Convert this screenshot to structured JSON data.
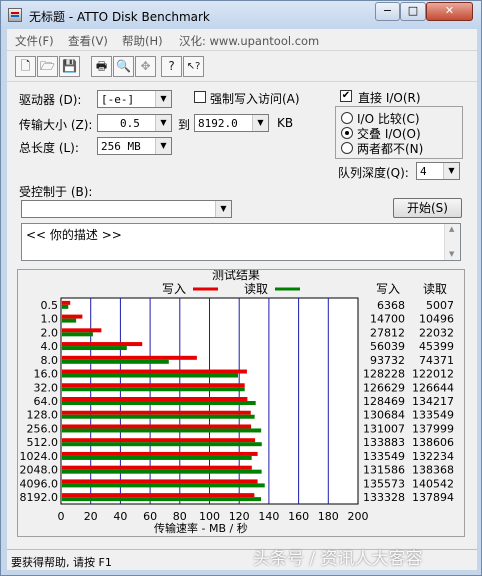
{
  "window": {
    "title": "无标题 - ATTO Disk Benchmark",
    "minimize": "−",
    "maximize": "□",
    "close": "✕"
  },
  "menu": [
    "文件(F)",
    "查看(V)",
    "帮助(H)",
    "汉化: www.upantool.com"
  ],
  "toolbar_icons": [
    "new-file-icon",
    "open-folder-icon",
    "save-icon",
    "print-icon",
    "print-preview-icon",
    "move-icon",
    "help-icon",
    "context-help-icon"
  ],
  "toolbar_glyphs": [
    "🗋",
    "🗁",
    "💾",
    "🖶",
    "🔍",
    "✥",
    "?",
    "↖?"
  ],
  "form": {
    "drive_label": "驱动器 (D):",
    "drive_value": "[-e-]",
    "force_write_label": "强制写入访问(A)",
    "transfer_label": "传输大小 (Z):",
    "transfer_from": "0.5",
    "to_label": "到",
    "transfer_to": "8192.0",
    "kb_label": "KB",
    "total_label": "总长度 (L):",
    "total_value": "256 MB",
    "direct_io_label": "直接 I/O(R)",
    "direct_io_check": "✔",
    "radio": [
      "I/O 比较(C)",
      "交叠 I/O(O)",
      "两者都不(N)"
    ],
    "queue_label": "队列深度(Q):",
    "queue_value": "4",
    "controlled_label": "受控制于 (B):",
    "controlled_value": "",
    "start_button": "开始(S)",
    "description": "<<  你的描述  >>"
  },
  "chart_data": {
    "type": "bar",
    "title": "测试结果",
    "xlabel": "传输速率 - MB / 秒",
    "xlim": [
      0,
      200
    ],
    "xticks": [
      "0",
      "20",
      "40",
      "60",
      "80",
      "100",
      "120",
      "140",
      "160",
      "180",
      "200"
    ],
    "categories": [
      "0.5",
      "1.0",
      "2.0",
      "4.0",
      "8.0",
      "16.0",
      "32.0",
      "64.0",
      "128.0",
      "256.0",
      "512.0",
      "1024.0",
      "2048.0",
      "4096.0",
      "8192.0"
    ],
    "legend": {
      "write": "写入",
      "read": "读取"
    },
    "colors": {
      "write": "#e60000",
      "read": "#008000"
    },
    "series": [
      {
        "name": "写入",
        "values": [
          6.2,
          14.4,
          27.2,
          54.7,
          91.5,
          125.2,
          123.7,
          125.5,
          127.8,
          128.0,
          130.7,
          132.4,
          128.5,
          132.4,
          130.2
        ]
      },
      {
        "name": "读取",
        "values": [
          4.9,
          10.2,
          21.5,
          44.3,
          72.6,
          119.2,
          123.7,
          131.1,
          130.4,
          134.8,
          135.2,
          128.4,
          135.1,
          137.2,
          134.7
        ]
      }
    ],
    "table_headers": [
      "写入",
      "读取"
    ],
    "write_kb": [
      "6368",
      "14700",
      "27812",
      "56039",
      "93732",
      "128228",
      "126629",
      "128469",
      "130684",
      "131007",
      "133883",
      "133549",
      "131586",
      "135573",
      "133328"
    ],
    "read_kb": [
      "5007",
      "10496",
      "22032",
      "45399",
      "74371",
      "122012",
      "126644",
      "134217",
      "133549",
      "137999",
      "138606",
      "132234",
      "138368",
      "140542",
      "137894"
    ]
  },
  "statusbar": {
    "text": "要获得帮助, 请按 F1",
    "watermark": "头条号 / 资讯人大客容"
  }
}
